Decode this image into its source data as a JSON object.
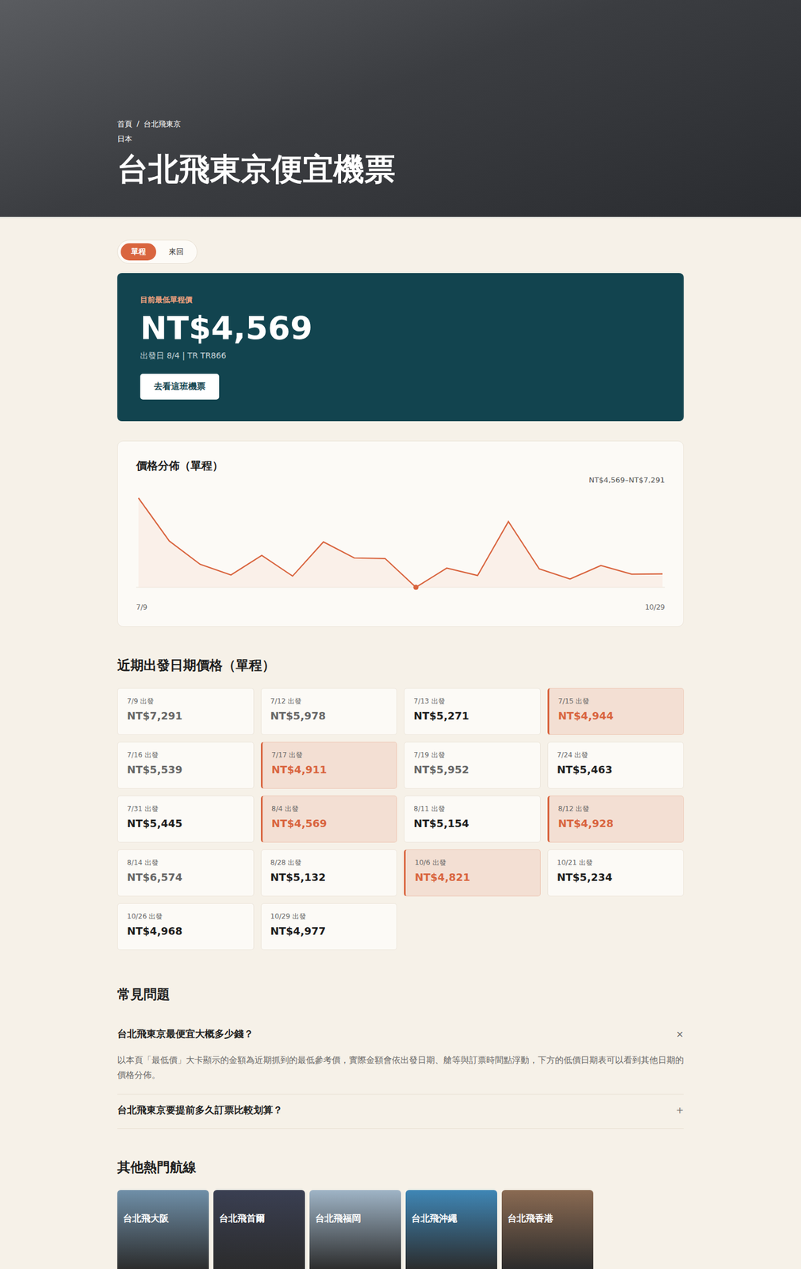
{
  "hero": {
    "breadcrumb": [
      {
        "label": "首頁"
      },
      {
        "label": "台北飛東京"
      }
    ],
    "separator": "/",
    "region": "日本",
    "title": "台北飛東京便宜機票"
  },
  "trip_tabs": [
    {
      "label": "單程",
      "selected": true
    },
    {
      "label": "來回",
      "selected": false
    }
  ],
  "lowest": {
    "label": "目前最低單程價",
    "price": "NT$4,569",
    "detail": "出發日 8/4 | TR TR866",
    "button": "去看這班機票"
  },
  "chart": {
    "title": "價格分佈（單程）",
    "range": "NT$4,569–NT$7,291",
    "x_start": "7/9",
    "x_end": "10/29",
    "values": [
      7291,
      5978,
      5271,
      4944,
      5539,
      4911,
      5952,
      5463,
      5445,
      4569,
      5154,
      4928,
      6574,
      5132,
      4821,
      5234,
      4968,
      4977
    ]
  },
  "dates": {
    "title": "近期出發日期價格（單程）",
    "items": [
      {
        "date": "7/9 出發",
        "price": "NT$7,291",
        "highlighted": false,
        "tier": "high"
      },
      {
        "date": "7/12 出發",
        "price": "NT$5,978",
        "highlighted": false,
        "tier": "high"
      },
      {
        "date": "7/13 出發",
        "price": "NT$5,271",
        "highlighted": false,
        "tier": "mid"
      },
      {
        "date": "7/15 出發",
        "price": "NT$4,944",
        "highlighted": true,
        "tier": "low"
      },
      {
        "date": "7/16 出發",
        "price": "NT$5,539",
        "highlighted": false,
        "tier": "high"
      },
      {
        "date": "7/17 出發",
        "price": "NT$4,911",
        "highlighted": true,
        "tier": "low"
      },
      {
        "date": "7/19 出發",
        "price": "NT$5,952",
        "highlighted": false,
        "tier": "high"
      },
      {
        "date": "7/24 出發",
        "price": "NT$5,463",
        "highlighted": false,
        "tier": "mid"
      },
      {
        "date": "7/31 出發",
        "price": "NT$5,445",
        "highlighted": false,
        "tier": "mid"
      },
      {
        "date": "8/4 出發",
        "price": "NT$4,569",
        "highlighted": true,
        "tier": "low"
      },
      {
        "date": "8/11 出發",
        "price": "NT$5,154",
        "highlighted": false,
        "tier": "mid"
      },
      {
        "date": "8/12 出發",
        "price": "NT$4,928",
        "highlighted": true,
        "tier": "low"
      },
      {
        "date": "8/14 出發",
        "price": "NT$6,574",
        "highlighted": false,
        "tier": "high"
      },
      {
        "date": "8/28 出發",
        "price": "NT$5,132",
        "highlighted": false,
        "tier": "mid"
      },
      {
        "date": "10/6 出發",
        "price": "NT$4,821",
        "highlighted": true,
        "tier": "low"
      },
      {
        "date": "10/21 出發",
        "price": "NT$5,234",
        "highlighted": false,
        "tier": "mid"
      },
      {
        "date": "10/26 出發",
        "price": "NT$4,968",
        "highlighted": false,
        "tier": "mid"
      },
      {
        "date": "10/29 出發",
        "price": "NT$4,977",
        "highlighted": false,
        "tier": "mid"
      }
    ]
  },
  "faq": {
    "title": "常見問題",
    "items": [
      {
        "question": "台北飛東京最便宜大概多少錢？",
        "answer": "以本頁「最低價」大卡顯示的金額為近期抓到的最低參考價，實際金額會依出發日期、艙等與訂票時間點浮動，下方的低價日期表可以看到其他日期的價格分佈。",
        "expanded": true,
        "icon": "×"
      },
      {
        "question": "台北飛東京要提前多久訂票比較划算？",
        "answer": "",
        "expanded": false,
        "icon": "+"
      }
    ]
  },
  "routes": {
    "title": "其他熱門航線",
    "items": [
      {
        "label": "台北飛大阪",
        "color": "#6f8fa8"
      },
      {
        "label": "台北飛首爾",
        "color": "#3a3f52"
      },
      {
        "label": "台北飛福岡",
        "color": "#9fb4c6"
      },
      {
        "label": "台北飛沖繩",
        "color": "#3f86b5"
      },
      {
        "label": "台北飛香港",
        "color": "#8a6a52"
      }
    ]
  }
}
